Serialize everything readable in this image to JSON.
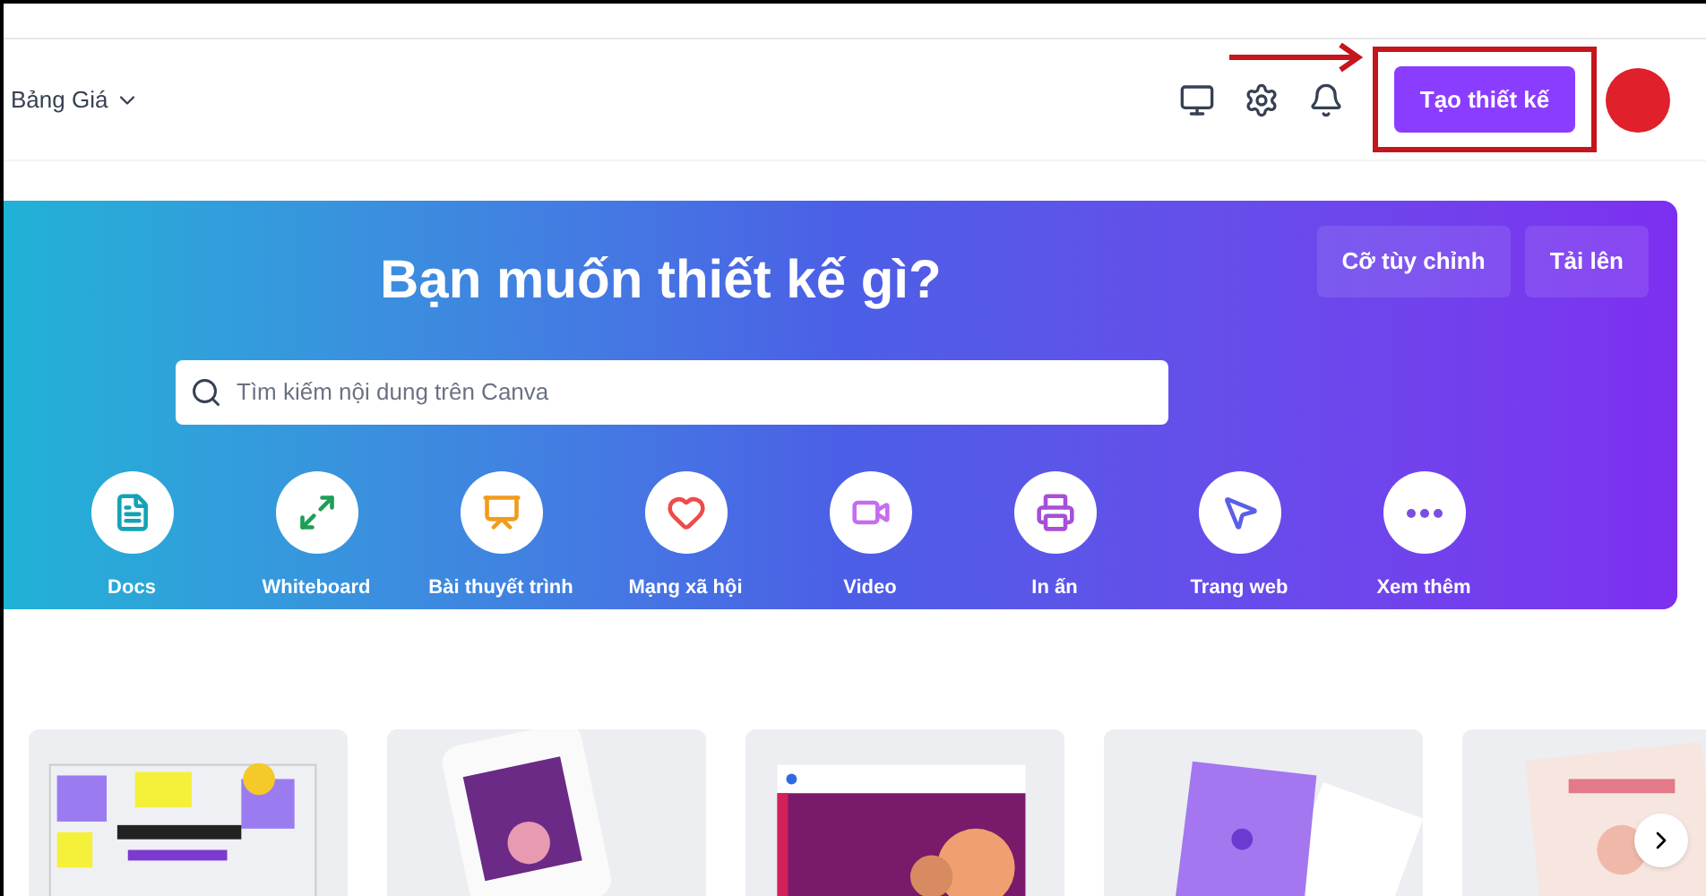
{
  "header": {
    "pricing_menu": "Bảng Giá",
    "create_button": "Tạo thiết kế"
  },
  "hero": {
    "title": "Bạn muốn thiết kế gì?",
    "buttons": [
      "Cỡ tùy chỉnh",
      "Tải lên"
    ],
    "search": {
      "placeholder": "Tìm kiếm nội dung trên Canva"
    },
    "categories": [
      {
        "label": "Docs",
        "kind": "docs",
        "color": "#13a3b5"
      },
      {
        "label": "Whiteboard",
        "kind": "whiteboard",
        "color": "#1e9e57"
      },
      {
        "label": "Bài thuyết trình",
        "kind": "presentation",
        "color": "#f29b1d"
      },
      {
        "label": "Mạng xã hội",
        "kind": "social",
        "color": "#f04a4a"
      },
      {
        "label": "Video",
        "kind": "video",
        "color": "#c56cf0"
      },
      {
        "label": "In ấn",
        "kind": "print",
        "color": "#a64fd8"
      },
      {
        "label": "Trang web",
        "kind": "website",
        "color": "#5b5fe8"
      },
      {
        "label": "Xem thêm",
        "kind": "more",
        "color": "#7a4fe0"
      }
    ]
  }
}
